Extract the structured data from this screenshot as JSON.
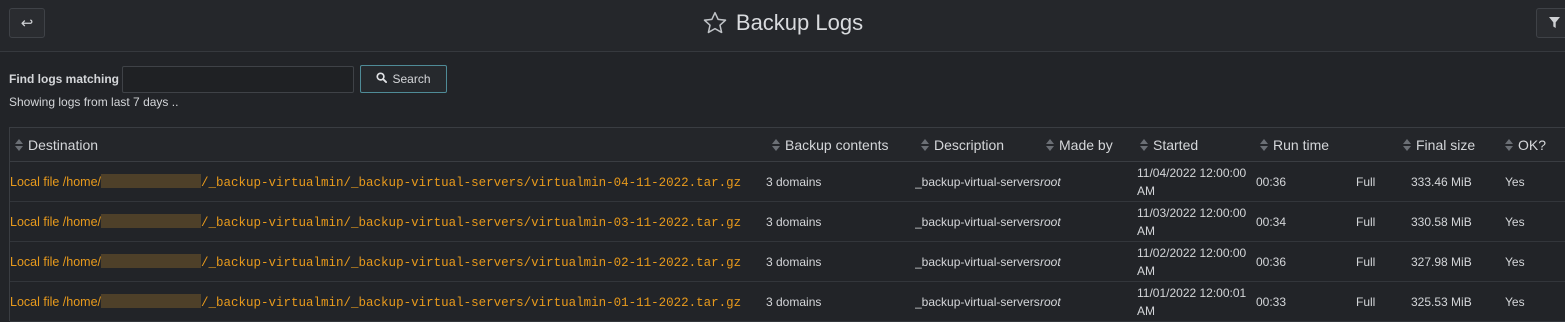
{
  "header": {
    "title": "Backup Logs",
    "back_icon": "back-arrow-icon",
    "star_icon": "star-icon",
    "filter_icon": "filter-icon"
  },
  "search": {
    "label": "Find logs matching",
    "value": "",
    "placeholder": "",
    "button_label": "Search",
    "showing_text": "Showing logs from last 7 days .."
  },
  "table": {
    "columns": [
      "Destination",
      "Backup contents",
      "Description",
      "Made by",
      "Started",
      "Run time",
      "",
      "Final size",
      "OK?"
    ],
    "rows": [
      {
        "dest_prefix": "Local file /home/",
        "dest_suffix": "/_backup-virtualmin/_backup-virtual-servers/virtualmin-04-11-2022.tar.gz",
        "contents": "3 domains",
        "description": "_backup-virtual-servers",
        "made_by": "root",
        "started": "11/04/2022 12:00:00 AM",
        "run_time": "00:36",
        "type": "Full",
        "final_size": "333.46 MiB",
        "ok": "Yes"
      },
      {
        "dest_prefix": "Local file /home/",
        "dest_suffix": "/_backup-virtualmin/_backup-virtual-servers/virtualmin-03-11-2022.tar.gz",
        "contents": "3 domains",
        "description": "_backup-virtual-servers",
        "made_by": "root",
        "started": "11/03/2022 12:00:00 AM",
        "run_time": "00:34",
        "type": "Full",
        "final_size": "330.58 MiB",
        "ok": "Yes"
      },
      {
        "dest_prefix": "Local file /home/",
        "dest_suffix": "/_backup-virtualmin/_backup-virtual-servers/virtualmin-02-11-2022.tar.gz",
        "contents": "3 domains",
        "description": "_backup-virtual-servers",
        "made_by": "root",
        "started": "11/02/2022 12:00:00 AM",
        "run_time": "00:36",
        "type": "Full",
        "final_size": "327.98 MiB",
        "ok": "Yes"
      },
      {
        "dest_prefix": "Local file /home/",
        "dest_suffix": "/_backup-virtualmin/_backup-virtual-servers/virtualmin-01-11-2022.tar.gz",
        "contents": "3 domains",
        "description": "_backup-virtual-servers",
        "made_by": "root",
        "started": "11/01/2022 12:00:01 AM",
        "run_time": "00:33",
        "type": "Full",
        "final_size": "325.53 MiB",
        "ok": "Yes"
      }
    ]
  },
  "colors": {
    "background": "#222428",
    "link": "#e89a1c",
    "search_button_border": "#4f8b97"
  }
}
